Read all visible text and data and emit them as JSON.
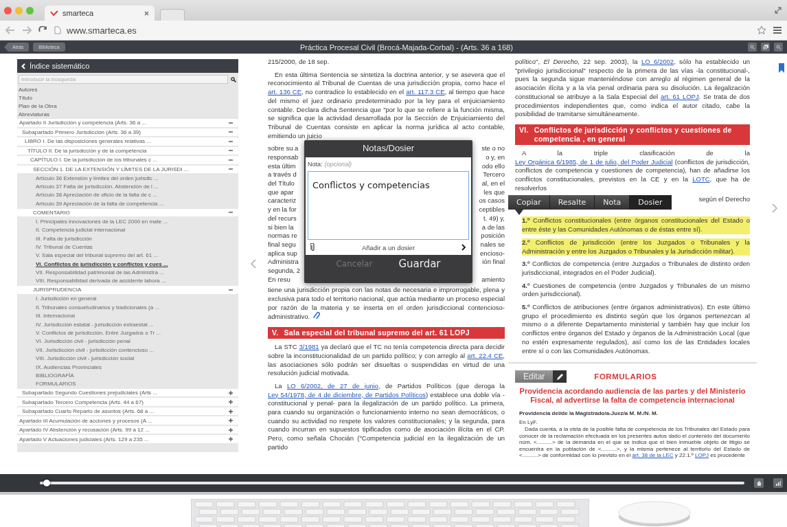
{
  "browser": {
    "tab_title": "smarteca",
    "url": "www.smarteca.es"
  },
  "toolbar": {
    "buttons": [
      "Atrás",
      "Biblioteca"
    ],
    "title": "Práctica Procesal Civil (Brocá-Majada-Corbal) - (Arts. 36 a 168)"
  },
  "sidebar": {
    "title": "Índice sistemático",
    "search_placeholder": "Introducir la búsqueda",
    "links": [
      "Autores",
      "Título",
      "Plan de la Obra",
      "Abreviaturas"
    ],
    "tree": [
      {
        "kind": "group",
        "label": "Apartado II Jurisdicción y competencia (Arts. 36 a ...",
        "expanded": true,
        "children": [
          {
            "kind": "group",
            "label": "Subapartado Primero Jurisdicción (Arts. 36 a 39)",
            "expanded": true,
            "children": [
              {
                "kind": "group",
                "label": "LIBRO I. De las disposiciones generales relativas ...",
                "expanded": true,
                "children": [
                  {
                    "kind": "group",
                    "label": "TÍTULO II. De la jurisdicción y de la competencia",
                    "expanded": true,
                    "children": [
                      {
                        "kind": "group",
                        "label": "CAPÍTULO I. De la jurisdicción de los tribunales c ...",
                        "expanded": true,
                        "children": [
                          {
                            "kind": "group",
                            "label": "SECCIÓN 1. DE LA EXTENSIÓN Y LÍMITES DE LA JURISDI ...",
                            "expanded": true,
                            "children": [
                              {
                                "kind": "item",
                                "label": "Artículo 36 Extensión y límites del orden jurisdic ...",
                                "selected": false
                              },
                              {
                                "kind": "item",
                                "label": "Artículo 37 Falta de jurisdicción. Abstención de l ...",
                                "selected": false
                              },
                              {
                                "kind": "item",
                                "label": "Artículo 38 Apreciación de oficio de la falta de c ...",
                                "selected": false
                              },
                              {
                                "kind": "item",
                                "label": "Artículo 39 Apreciación de la falta de competencia ...",
                                "selected": false
                              },
                              {
                                "kind": "group",
                                "label": "COMENTARIO",
                                "expanded": true,
                                "children": [
                                  {
                                    "kind": "item",
                                    "label": "I. Principales innovaciones de la LEC 2000 en mate ...",
                                    "selected": false
                                  },
                                  {
                                    "kind": "item",
                                    "label": "II. Competencia judicial internacional",
                                    "selected": false
                                  },
                                  {
                                    "kind": "item",
                                    "label": "III. Falta de jurisdicción",
                                    "selected": false
                                  },
                                  {
                                    "kind": "item",
                                    "label": "IV. Tribunal de Cuentas",
                                    "selected": false
                                  },
                                  {
                                    "kind": "item",
                                    "label": "V. Sala especial del tribunal supremo del art. 61 ...",
                                    "selected": false
                                  },
                                  {
                                    "kind": "item",
                                    "label": "VI. Conflictos de jurisdicción y conflictos y cues ...",
                                    "selected": true
                                  },
                                  {
                                    "kind": "item",
                                    "label": "VII. Responsabilidad patrimonial de las Administra ...",
                                    "selected": false
                                  },
                                  {
                                    "kind": "item",
                                    "label": "VIII. Responsabilidad derivada de accidente labora ...",
                                    "selected": false
                                  }
                                ]
                              },
                              {
                                "kind": "group",
                                "label": "JURISPRUDENCIA",
                                "expanded": true,
                                "children": [
                                  {
                                    "kind": "item",
                                    "label": "I. Jurisdicción en general",
                                    "selected": false
                                  },
                                  {
                                    "kind": "item",
                                    "label": "II. Tribunales consuetudinarios y tradicionales (a ...",
                                    "selected": false
                                  },
                                  {
                                    "kind": "item",
                                    "label": "III. Internacional",
                                    "selected": false
                                  },
                                  {
                                    "kind": "item",
                                    "label": "IV. Jurisdicción estatal - jurisdicción extraestat ...",
                                    "selected": false
                                  },
                                  {
                                    "kind": "item",
                                    "label": "V. Conflictos de jurisdicción. Entre Juzgados o Tr ...",
                                    "selected": false
                                  },
                                  {
                                    "kind": "item",
                                    "label": "VI. Jurisdicción civil - jurisdicción penal",
                                    "selected": false
                                  },
                                  {
                                    "kind": "item",
                                    "label": "VII. Jurisdicción civil - jurisdicción contencioso ...",
                                    "selected": false
                                  },
                                  {
                                    "kind": "item",
                                    "label": "VIII. Jurisdicción civil - jurisdicción social",
                                    "selected": false
                                  },
                                  {
                                    "kind": "item",
                                    "label": "IX. Audiencias Provinciales",
                                    "selected": false
                                  }
                                ]
                              },
                              {
                                "kind": "item",
                                "label": "BIBLIOGRAFÍA",
                                "selected": false
                              },
                              {
                                "kind": "item",
                                "label": "FORMULARIOS",
                                "selected": false
                              }
                            ]
                          }
                        ]
                      }
                    ]
                  }
                ]
              }
            ]
          },
          {
            "kind": "group",
            "label": "Subapartado Segundo Cuestiones prejudiciales (Arts ...",
            "expanded": false
          },
          {
            "kind": "group",
            "label": "Subapartado Tercero Competencia (Arts. 44 a 67)",
            "expanded": false
          },
          {
            "kind": "group",
            "label": "Subapartado Cuarto Reparto de asuntos (Arts. 68 a ...",
            "expanded": false
          }
        ]
      },
      {
        "kind": "group",
        "label": "Apartado III Acumulación de acciones y procesos (A ...",
        "expanded": false
      },
      {
        "kind": "group",
        "label": "Apartado IV Abstención y recusación (Arts. 99 a 12 ...",
        "expanded": false
      },
      {
        "kind": "group",
        "label": "Apartado V Actuaciones judiciales (Arts. 129 a 235 ...",
        "expanded": false
      }
    ]
  },
  "middle": {
    "blocks": [
      {
        "kind": "line",
        "parts": [
          {
            "kind": "text",
            "text": "215/2000, de 18 sep."
          }
        ]
      },
      {
        "kind": "para",
        "parts": [
          {
            "kind": "text",
            "text": "En esta última Sentencia se sintetiza la doctrina anterior, y se asevera que el reconocimiento al Tribunal de Cuentas de una jurisdicción propia, como hace el "
          },
          {
            "kind": "link",
            "text": "art. 136 CE"
          },
          {
            "kind": "text",
            "text": ", no contradice lo establecido en el "
          },
          {
            "kind": "link",
            "text": "art. 117.3 CE"
          },
          {
            "kind": "text",
            "text": ", al tiempo que hace del mismo el juez ordinario predeterminado por la ley para el enjuiciamiento contable. Declara dicha Sentencia que \"por lo que se refiere a la función misma, se significa que la actividad desarrollada por la Sección de Enjuiciamiento del Tribunal de Cuentas consiste en aplicar la norma jurídica al acto contable, emitiendo un juicio"
          }
        ]
      },
      {
        "kind": "fragments",
        "rows": [
          {
            "left": "sobre su a",
            "right": "ste o no"
          },
          {
            "left": "responsab",
            "right": "o y, en"
          },
          {
            "left": "esta últim",
            "right": "odo ello"
          },
          {
            "left": "a través d",
            "right": "Tercero"
          },
          {
            "left": "del Título",
            "right": "al, en el"
          },
          {
            "left": "que apar",
            "right": "les que"
          },
          {
            "left": "caracteriz",
            "right": "os casos"
          },
          {
            "left": "y en la for",
            "right": "ceptibles"
          },
          {
            "left": "del recurs",
            "right": "t. 49) y,"
          },
          {
            "left": "si bien la",
            "right": "a de las"
          },
          {
            "left": "normas re",
            "right": "posición"
          },
          {
            "left": "final segu",
            "right": "nales se"
          },
          {
            "left": "aplica sup",
            "right": "encioso-"
          },
          {
            "left": "Administra",
            "right": "ión final"
          },
          {
            "left": "segunda, 2",
            "right": ""
          },
          {
            "left": "En resu",
            "right": "amiento"
          }
        ]
      },
      {
        "kind": "line",
        "attachment": true,
        "parts": [
          {
            "kind": "text",
            "text": "tiene una jurisdicción propia con las notas de necesaria e improrrogable, plena y exclusiva para todo el territorio nacional, que actúa mediante un proceso especial por razón de la materia y se inserta en el orden jurisdiccional contencioso-administrativo."
          }
        ]
      },
      {
        "kind": "heading",
        "number": "V.",
        "title": "Sala especial del tribunal supremo del art. 61 LOPJ"
      },
      {
        "kind": "para",
        "parts": [
          {
            "kind": "text",
            "text": "La STC "
          },
          {
            "kind": "link",
            "text": "3/1981"
          },
          {
            "kind": "text",
            "text": " ya declaró que el TC no tenía competencia directa para decidir sobre la inconstitucionalidad de un partido político; y con arreglo al "
          },
          {
            "kind": "link",
            "text": "art. 22.4 CE"
          },
          {
            "kind": "text",
            "text": ", las asociaciones sólo podrán ser disueltas o suspendidas en virtud de una resolución judicial motivada."
          }
        ]
      },
      {
        "kind": "para",
        "parts": [
          {
            "kind": "text",
            "text": "La "
          },
          {
            "kind": "link",
            "text": "LO 6/2002, de 27 de junio"
          },
          {
            "kind": "text",
            "text": ", de Partidos Políticos (que deroga la "
          },
          {
            "kind": "link",
            "text": "Ley 54/1978, de 4 de diciembre, de Partidos Políticos"
          },
          {
            "kind": "text",
            "text": ") establece una doble vía -constitucional y penal- para la ilegalización de un partido político. La primera, para cuando su organización o funcionamiento interno no sean democráticos, o cuando su actividad no respete los valores constitucionales; y la segunda, para cuando incurran en supuestos tipificados como de asociación ilícita en el CP. Pero, como señala Chocián (\"Competencia judicial en la ilegalización de un partido"
          }
        ]
      }
    ]
  },
  "modal": {
    "title": "Notas/Dosier",
    "note_label": "Nota:",
    "note_placeholder": "(opcional)",
    "note_text": "Conflictos y competencias",
    "dossier_label": "Añadir a un dosier",
    "buttons": [
      {
        "label": "Cancelar",
        "disabled": true
      },
      {
        "label": "Guardar",
        "disabled": false
      }
    ]
  },
  "right": {
    "blocks": [
      {
        "kind": "line",
        "parts": [
          {
            "kind": "text",
            "text": "político\", *El Derecho*, 22 sep. 2003), la "
          },
          {
            "kind": "link",
            "text": "LO 6/2002"
          },
          {
            "kind": "text",
            "text": ", sólo ha establecido un \"privilegio jurisdiccional\" respecto de la primera de las vías -la constitucional-, pues la segunda sigue manteniéndose con arreglo al régimen general de la asociación ilícita y a la vía penal ordinaria para su disolución. La ilegalización constitucional se atribuye a la Sala Especial del "
          },
          {
            "kind": "link",
            "text": "art. 61 LOPJ"
          },
          {
            "kind": "text",
            "text": ". Se trata de dos procedimientos independientes que, como indica el autor citado, cabe la posibilidad de tramitarse simultáneamente."
          }
        ]
      },
      {
        "kind": "heading",
        "number": "VI.",
        "title": "Conflictos de jurisdicción y conflictos y cuestiones de competencia , en general"
      },
      {
        "kind": "para",
        "parts": [
          {
            "kind": "text",
            "text": "A la triple clasificación de la "
          },
          {
            "kind": "link",
            "text": "Ley Orgánica 6/1985, de 1 de julio, del Poder Judicial"
          },
          {
            "kind": "text",
            "text": " (conflictos de jurisdicción, conflictos de competencia y cuestiones de competencia), han de añadirse los conflictos constitucionales, previstos en la CE y en la "
          },
          {
            "kind": "link",
            "text": "LOTC"
          },
          {
            "kind": "text",
            "text": ", que ha de resolverlos"
          }
        ]
      },
      {
        "kind": "selection",
        "buttons": [
          {
            "label": "Copiar",
            "selected": false
          },
          {
            "label": "Resalte",
            "selected": false
          },
          {
            "label": "Nota",
            "selected": false
          },
          {
            "label": "Dosier",
            "selected": true
          }
        ],
        "right": "según el Derecho"
      },
      {
        "kind": "item",
        "highlighted": true,
        "text": "**1.º** Conflictos constitucionales (entre órganos constitucionales del Estado o entre éste y las Comunidades Autónomas o de éstas entre sí)."
      },
      {
        "kind": "item",
        "highlighted": true,
        "text": "**2.º** Conflictos de jurisdicción (entre los Juzgados o Tribunales y la Administración y entre los Juzgados o Tribunales y la Jurisdicción militar)."
      },
      {
        "kind": "item",
        "highlighted": false,
        "text": "**3.º** Conflictos de competencia (entre Juzgados o Tribunales de distinto orden jurisdiccional, integrados en el Poder Judicial)."
      },
      {
        "kind": "item",
        "highlighted": false,
        "text": "**4.º** Cuestiones de competencia (entre Juzgados y Tribunales de un mismo orden jurisdiccional)."
      },
      {
        "kind": "item",
        "highlighted": false,
        "text": "**5.º** Conflictos de atribuciones (entre órganos administrativos). En este último grupo el procedimiento es distinto según que los órganos pertenezcan al mismo o a diferente Departamento ministerial y también hay que incluir los conflictos entre órganos del Estado y órganos de la Administración Local (que no estén expresamente regulados), así como los de las Entidades locales entre sí o con las Comunidades Autónomas."
      }
    ],
    "form": {
      "edit_button": "Editar",
      "title": "FORMULARIOS",
      "subtitle": "Providencia acordando audiencia de las partes y del Ministerio Fiscal, al advertirse la falta de competencia internacional",
      "doc_title": "Providencia del/de la Magistrado/a-Juez/a M. M./N. M.",
      "place": "En LyF.",
      "body": [
        {
          "kind": "text",
          "text": "Dada cuenta, a la vista de la posible falta de competencia de los Tribunales del Estado para conocer de la reclamación efectuada en los presentes autos dado el contenido del documento núm. <..........> de la demanda en el que se indica que el bien inmueble objeto de litigio se encuentra en la población de <..........>, y la misma pertenece al territorio del Estado de <..........> de conformidad con lo previsto en el "
        },
        {
          "kind": "link",
          "text": "art. 38 de la LEC"
        },
        {
          "kind": "text",
          "text": " y 22.1.º "
        },
        {
          "kind": "link",
          "text": "LOPJ"
        },
        {
          "kind": "text",
          "text": " es procedente"
        }
      ]
    }
  },
  "reader": {
    "level": 0.01
  }
}
